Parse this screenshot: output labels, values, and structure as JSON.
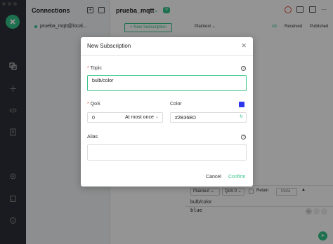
{
  "connections": {
    "title": "Connections",
    "items": [
      {
        "name": "prueba_mqtt@local..."
      }
    ]
  },
  "main": {
    "title": "prueba_mqtt",
    "badge": "0",
    "new_sub_button": "+ New Subscription",
    "payload_format": "Plaintext",
    "filters": [
      "All",
      "Received",
      "Published"
    ],
    "bottom": {
      "payload_format": "Plaintext",
      "qos": "QoS 0",
      "retain": "Retain",
      "meta": "Meta",
      "topic": "bulb/color",
      "payload": "blue"
    }
  },
  "modal": {
    "title": "New Subscription",
    "topic_label": "Topic",
    "topic_value": "bulb/color",
    "qos_label": "QoS",
    "qos_value": "0",
    "qos_text": "At most once",
    "color_label": "Color",
    "color_value": "#2B36ED",
    "alias_label": "Alias",
    "alias_value": "",
    "cancel_label": "Cancel",
    "confirm_label": "Confirm",
    "accent": "#34c388",
    "swatch": "#2B36ED"
  }
}
